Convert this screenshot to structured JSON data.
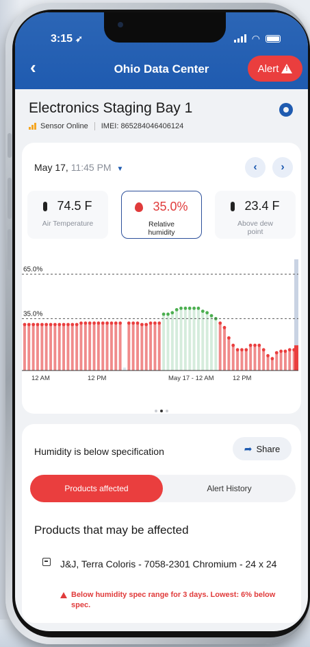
{
  "status_bar": {
    "time": "3:15",
    "location_icon": "location-arrow-icon"
  },
  "header": {
    "back_icon": "chevron-left-icon",
    "title": "Ohio Data Center",
    "alert_label": "Alert",
    "alert_icon": "warning-triangle-icon"
  },
  "device": {
    "title": "Electronics Staging Bay 1",
    "status": "Sensor Online",
    "imei": "IMEI: 865284046406124",
    "settings_icon": "gear-icon"
  },
  "reading": {
    "date": "May 17,",
    "time": "11:45 PM",
    "metrics": [
      {
        "value": "74.5 F",
        "label": "Air Temperature",
        "icon": "thermometer-icon"
      },
      {
        "value": "35.0%",
        "label": "Relative humidity",
        "icon": "water-drop-icon"
      },
      {
        "value": "23.4 F",
        "label": "Above dew point",
        "icon": "thermometer-icon"
      }
    ]
  },
  "chart_data": {
    "type": "bar",
    "upper_threshold_label": "65.0%",
    "lower_threshold_label": "35.0%",
    "upper_threshold": 65.0,
    "lower_threshold": 35.0,
    "x_tick_labels": [
      "12 AM",
      "12 PM",
      "May 17 - 12 AM",
      "12 PM"
    ],
    "ylim": [
      0,
      75
    ],
    "values": [
      31,
      31,
      31,
      31,
      31,
      31,
      31,
      31,
      31,
      31,
      31,
      31,
      31,
      32,
      32,
      32,
      32,
      32,
      32,
      32,
      32,
      32,
      32,
      2,
      32,
      32,
      32,
      31,
      31,
      32,
      32,
      32,
      38,
      38,
      39,
      41,
      42,
      42,
      42,
      42,
      42,
      40,
      39,
      37,
      35,
      32,
      29,
      22,
      17,
      14,
      14,
      14,
      17,
      17,
      17,
      14,
      10,
      8,
      12,
      13,
      13,
      14,
      14
    ],
    "point_status": [
      "below",
      "below",
      "below",
      "below",
      "below",
      "below",
      "below",
      "below",
      "below",
      "below",
      "below",
      "below",
      "below",
      "below",
      "below",
      "below",
      "below",
      "below",
      "below",
      "below",
      "below",
      "below",
      "below",
      "none",
      "below",
      "below",
      "below",
      "below",
      "below",
      "below",
      "below",
      "below",
      "ok",
      "ok",
      "ok",
      "ok",
      "ok",
      "ok",
      "ok",
      "ok",
      "ok",
      "ok",
      "ok",
      "ok",
      "ok",
      "below",
      "below",
      "below",
      "below",
      "below",
      "below",
      "below",
      "below",
      "below",
      "below",
      "below",
      "below",
      "below",
      "below",
      "below",
      "below",
      "below",
      "below"
    ]
  },
  "pager": {
    "count": 3,
    "active": 1
  },
  "spec": {
    "title": "Humidity is below specification",
    "share_label": "Share",
    "share_icon": "share-arrow-icon",
    "tabs": [
      "Products affected",
      "Alert History"
    ],
    "products_heading": "Products that may be affected",
    "product_name": "J&J, Terra Coloris - 7058-2301 Chromium - 24 x 24",
    "product_icon": "box-icon",
    "warning": "Below humidity spec range for 3 days. Lowest: 6% below spec.",
    "warning_icon": "warning-triangle-icon"
  },
  "colors": {
    "header_blue": "#1f5bb0",
    "alert_red": "#ea3e3e",
    "ok_green": "#4caf50",
    "bar_red": "#f08b8b",
    "bar_green": "#d5ecdc"
  }
}
